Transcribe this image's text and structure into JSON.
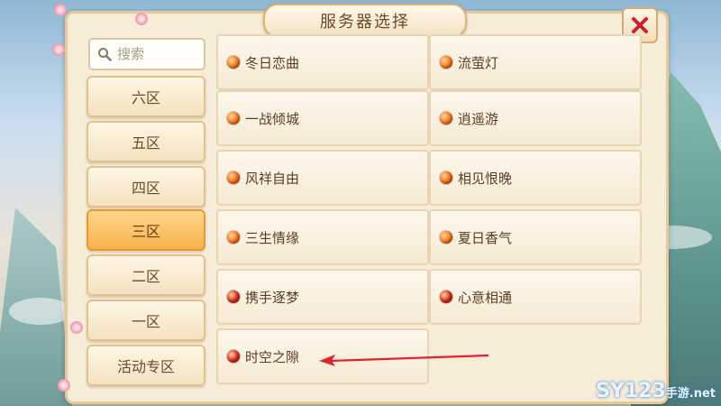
{
  "dialog": {
    "title": "服务器选择"
  },
  "search": {
    "placeholder": "搜索"
  },
  "zones": [
    {
      "label": "六区",
      "active": false
    },
    {
      "label": "五区",
      "active": false
    },
    {
      "label": "四区",
      "active": false
    },
    {
      "label": "三区",
      "active": true
    },
    {
      "label": "二区",
      "active": false
    },
    {
      "label": "一区",
      "active": false
    },
    {
      "label": "活动专区",
      "active": false
    }
  ],
  "servers": [
    {
      "name": "冬日恋曲",
      "status_color": "#ff7a1a"
    },
    {
      "name": "流萤灯",
      "status_color": "#ff7a1a"
    },
    {
      "name": "一战倾城",
      "status_color": "#ff7a1a"
    },
    {
      "name": "逍遥游",
      "status_color": "#ff7a1a"
    },
    {
      "name": "风祥自由",
      "status_color": "#ff6a10"
    },
    {
      "name": "相见恨晚",
      "status_color": "#ff6a10"
    },
    {
      "name": "三生情缘",
      "status_color": "#ff7a1a"
    },
    {
      "name": "夏日香气",
      "status_color": "#ff7a1a"
    },
    {
      "name": "携手逐梦",
      "status_color": "#d9281a"
    },
    {
      "name": "心意相通",
      "status_color": "#d9281a"
    },
    {
      "name": "时空之隙",
      "status_color": "#d9281a"
    }
  ],
  "watermark": {
    "text": "SY123",
    "suffix": "手游.net"
  },
  "colors": {
    "accent": "#f6b14c",
    "close": "#c8232d",
    "arrow": "#e0232e"
  }
}
